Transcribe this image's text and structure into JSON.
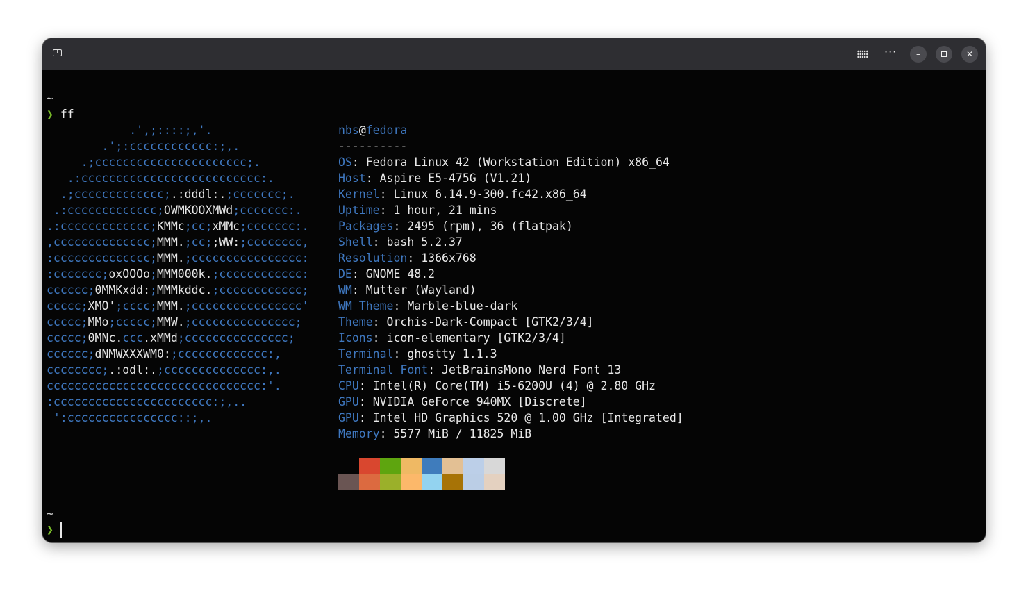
{
  "terminal": {
    "command_prompt_tilde": "~",
    "prompt_symbol": "❯",
    "command": "ff",
    "second_prompt_tilde": "~"
  },
  "logo_lines": [
    [
      [
        "b",
        "            .',;::::;,'."
      ]
    ],
    [
      [
        "b",
        "        .';:cccccccccccc:;,."
      ]
    ],
    [
      [
        "b",
        "     .;cccccccccccccccccccccc;."
      ]
    ],
    [
      [
        "b",
        "   .:cccccccccccccccccccccccccc:."
      ]
    ],
    [
      [
        "b",
        "  .;ccccccccccccc;"
      ],
      [
        "w",
        ".:dddl:."
      ],
      [
        "b",
        ";ccccccc;."
      ]
    ],
    [
      [
        "b",
        " .:ccccccccccccc;"
      ],
      [
        "w",
        "OWMKOOXMWd"
      ],
      [
        "b",
        ";ccccccc:."
      ]
    ],
    [
      [
        "b",
        ".:ccccccccccccc;"
      ],
      [
        "w",
        "KMMc"
      ],
      [
        "b",
        ";cc;"
      ],
      [
        "w",
        "xMMc"
      ],
      [
        "b",
        ";ccccccc:."
      ]
    ],
    [
      [
        "b",
        ",cccccccccccccc;"
      ],
      [
        "w",
        "MMM."
      ],
      [
        "b",
        ";cc;"
      ],
      [
        "w",
        ";WW:"
      ],
      [
        "b",
        ";cccccccc,"
      ]
    ],
    [
      [
        "b",
        ":cccccccccccccc;"
      ],
      [
        "w",
        "MMM."
      ],
      [
        "b",
        ";cccccccccccccccc:"
      ]
    ],
    [
      [
        "b",
        ":ccccccc;"
      ],
      [
        "w",
        "oxOOOo"
      ],
      [
        "b",
        ";"
      ],
      [
        "w",
        "MMM000k."
      ],
      [
        "b",
        ";cccccccccccc:"
      ]
    ],
    [
      [
        "b",
        "cccccc;"
      ],
      [
        "w",
        "0MMKxdd:"
      ],
      [
        "b",
        ";"
      ],
      [
        "w",
        "MMMkddc."
      ],
      [
        "b",
        ";cccccccccccc;"
      ]
    ],
    [
      [
        "b",
        "ccccc;"
      ],
      [
        "w",
        "XMO'"
      ],
      [
        "b",
        ";cccc;"
      ],
      [
        "w",
        "MMM."
      ],
      [
        "b",
        ";cccccccccccccccc'"
      ]
    ],
    [
      [
        "b",
        "ccccc;"
      ],
      [
        "w",
        "MMo"
      ],
      [
        "b",
        ";ccccc;"
      ],
      [
        "w",
        "MMW."
      ],
      [
        "b",
        ";ccccccccccccccc;"
      ]
    ],
    [
      [
        "b",
        "ccccc;"
      ],
      [
        "w",
        "0MNc."
      ],
      [
        "b",
        "ccc"
      ],
      [
        "w",
        ".xMMd"
      ],
      [
        "b",
        ";ccccccccccccccc;"
      ]
    ],
    [
      [
        "b",
        "cccccc;"
      ],
      [
        "w",
        "dNMWXXXWM0:"
      ],
      [
        "b",
        ";ccccccccccccc:,"
      ]
    ],
    [
      [
        "b",
        "cccccccc;"
      ],
      [
        "w",
        ".:odl:."
      ],
      [
        "b",
        ";cccccccccccccc:,."
      ]
    ],
    [
      [
        "b",
        "ccccccccccccccccccccccccccccccc:'."
      ]
    ],
    [
      [
        "b",
        ":ccccccccccccccccccccccc:;,.."
      ]
    ],
    [
      [
        "b",
        " ':cccccccccccccccc::;,."
      ]
    ]
  ],
  "user": "nbs",
  "at": "@",
  "host": "fedora",
  "separator": "----------",
  "info": [
    {
      "key": "OS",
      "value": "Fedora Linux 42 (Workstation Edition) x86_64"
    },
    {
      "key": "Host",
      "value": "Aspire E5-475G (V1.21)"
    },
    {
      "key": "Kernel",
      "value": "Linux 6.14.9-300.fc42.x86_64"
    },
    {
      "key": "Uptime",
      "value": "1 hour, 21 mins"
    },
    {
      "key": "Packages",
      "value": "2495 (rpm), 36 (flatpak)"
    },
    {
      "key": "Shell",
      "value": "bash 5.2.37"
    },
    {
      "key": "Resolution",
      "value": "1366x768"
    },
    {
      "key": "DE",
      "value": "GNOME 48.2"
    },
    {
      "key": "WM",
      "value": "Mutter (Wayland)"
    },
    {
      "key": "WM Theme",
      "value": "Marble-blue-dark"
    },
    {
      "key": "Theme",
      "value": "Orchis-Dark-Compact [GTK2/3/4]"
    },
    {
      "key": "Icons",
      "value": "icon-elementary [GTK2/3/4]"
    },
    {
      "key": "Terminal",
      "value": "ghostty 1.1.3"
    },
    {
      "key": "Terminal Font",
      "value": "JetBrainsMono Nerd Font 13"
    },
    {
      "key": "CPU",
      "value": "Intel(R) Core(TM) i5-6200U (4) @ 2.80 GHz"
    },
    {
      "key": "GPU",
      "value": "NVIDIA GeForce 940MX [Discrete]"
    },
    {
      "key": "GPU",
      "value": "Intel HD Graphics 520 @ 1.00 GHz [Integrated]"
    },
    {
      "key": "Memory",
      "value": "5577 MiB / 11825 MiB"
    }
  ],
  "palette": {
    "row1": [
      "#050505",
      "#d9472f",
      "#5ea50f",
      "#efb964",
      "#3f7cbc",
      "#e3c094",
      "#bccfe8",
      "#d8d8d8"
    ],
    "row2": [
      "#6a5553",
      "#dc6a40",
      "#9bb02a",
      "#fcb86a",
      "#93d3f0",
      "#a77306",
      "#bbcee6",
      "#e4d1c0"
    ]
  },
  "colors": {
    "key_blue": "#3f78c0",
    "prompt_green": "#7bbf2a",
    "text": "#e8e8e8",
    "background": "#050505",
    "titlebar": "#2e2e32"
  }
}
